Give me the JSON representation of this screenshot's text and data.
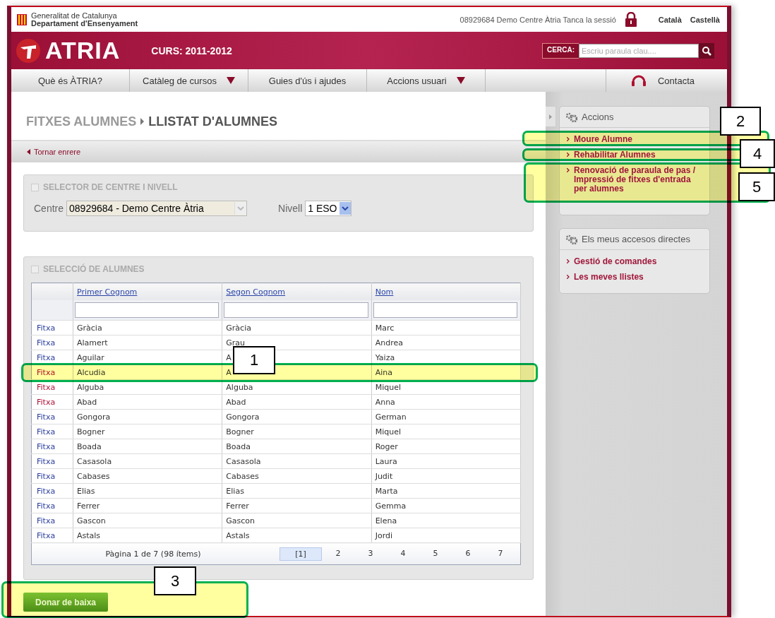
{
  "header": {
    "org_line1": "Generalitat de Catalunya",
    "org_line2": "Departament d'Ensenyament",
    "user": "08929684 Demo Centre Àtria",
    "logout": "Tanca la sessió",
    "languages": [
      "Català",
      "Castellà"
    ]
  },
  "banner": {
    "logo": "ATRIA",
    "course": "CURS: 2011-2012",
    "search_label": "CERCA:",
    "search_placeholder": "Escriu paraula clau...."
  },
  "nav": [
    {
      "label": "Què és ÀTRIA?",
      "dropdown": false
    },
    {
      "label": "Catàleg de cursos",
      "dropdown": true
    },
    {
      "label": "Guies d'ús i ajudes",
      "dropdown": false
    },
    {
      "label": "Accions usuari",
      "dropdown": true
    }
  ],
  "contact": "Contacta",
  "breadcrumb": [
    "FITXES ALUMNES",
    "LLISTAT D'ALUMNES"
  ],
  "back_link": "Tornar enrere",
  "selector_panel": {
    "title": "SELECTOR DE CENTRE I NIVELL",
    "centre": {
      "label": "Centre",
      "value": "08929684 - Demo Centre Àtria",
      "disabled": true
    },
    "nivell": {
      "label": "Nivell",
      "value": "1 ESO",
      "disabled": false
    }
  },
  "students_panel": {
    "title": "SELECCIÓ DE ALUMNES",
    "columns": [
      "Primer Cognom",
      "Segon Cognom",
      "Nom"
    ],
    "rows": [
      {
        "link": "Fitxa",
        "cells": [
          "Gràcia",
          "Gràcia",
          "Marc"
        ],
        "visited": false
      },
      {
        "link": "Fitxa",
        "cells": [
          "Alamert",
          "Grau",
          "Andrea"
        ],
        "visited": false
      },
      {
        "link": "Fitxa",
        "cells": [
          "Aguilar",
          "A",
          "Yaiza"
        ],
        "visited": false
      },
      {
        "link": "Fitxa",
        "cells": [
          "Alcudia",
          "A",
          "Aina"
        ],
        "visited": true
      },
      {
        "link": "Fitxa",
        "cells": [
          "Alguba",
          "Alguba",
          "Miquel"
        ],
        "visited": true
      },
      {
        "link": "Fitxa",
        "cells": [
          "Abad",
          "Abad",
          "Anna"
        ],
        "visited": true
      },
      {
        "link": "Fitxa",
        "cells": [
          "Gongora",
          "Gongora",
          "German"
        ],
        "visited": false
      },
      {
        "link": "Fitxa",
        "cells": [
          "Bogner",
          "Bogner",
          "Miquel"
        ],
        "visited": false
      },
      {
        "link": "Fitxa",
        "cells": [
          "Boada",
          "Boada",
          "Roger"
        ],
        "visited": false
      },
      {
        "link": "Fitxa",
        "cells": [
          "Casasola",
          "Casasola",
          "Laura"
        ],
        "visited": false
      },
      {
        "link": "Fitxa",
        "cells": [
          "Cabases",
          "Cabases",
          "Judit"
        ],
        "visited": false
      },
      {
        "link": "Fitxa",
        "cells": [
          "Elias",
          "Elias",
          "Marta"
        ],
        "visited": false
      },
      {
        "link": "Fitxa",
        "cells": [
          "Ferrer",
          "Ferrer",
          "Gemma"
        ],
        "visited": false
      },
      {
        "link": "Fitxa",
        "cells": [
          "Gascon",
          "Gascon",
          "Elena"
        ],
        "visited": false
      },
      {
        "link": "Fitxa",
        "cells": [
          "Astals",
          "Astals",
          "Jordi"
        ],
        "visited": false
      }
    ],
    "pager": {
      "summary": "Pàgina 1 de 7 (98 ítems)",
      "pages": [
        {
          "label": "[1]",
          "selected": true
        },
        {
          "label": "2",
          "selected": false
        },
        {
          "label": "3",
          "selected": false
        },
        {
          "label": "4",
          "selected": false
        },
        {
          "label": "5",
          "selected": false
        },
        {
          "label": "6",
          "selected": false
        },
        {
          "label": "7",
          "selected": false
        }
      ]
    }
  },
  "primary_button": "Donar de baixa",
  "sidebar": [
    {
      "title": "Accions",
      "links": [
        "Moure Alumne",
        "Rehabilitar Alumnes",
        "Renovació de paraula de pas / Impressió de fitxes d'entrada per alumnes"
      ]
    },
    {
      "title": "Els meus accesos directes",
      "links": [
        "Gestió de comandes",
        "Les meves llistes"
      ]
    }
  ],
  "annotations": [
    {
      "label": "1"
    },
    {
      "label": "2"
    },
    {
      "label": "3"
    },
    {
      "label": "4"
    },
    {
      "label": "5"
    }
  ]
}
